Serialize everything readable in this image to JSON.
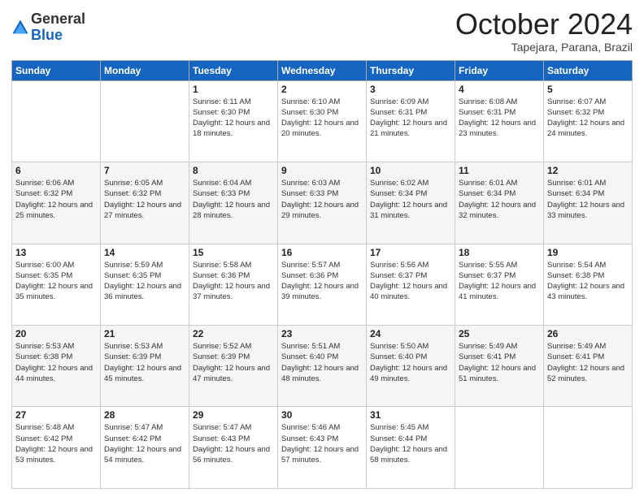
{
  "header": {
    "logo": {
      "line1": "General",
      "line2": "Blue"
    },
    "title": "October 2024",
    "subtitle": "Tapejara, Parana, Brazil"
  },
  "days_of_week": [
    "Sunday",
    "Monday",
    "Tuesday",
    "Wednesday",
    "Thursday",
    "Friday",
    "Saturday"
  ],
  "weeks": [
    [
      {
        "day": "",
        "info": ""
      },
      {
        "day": "",
        "info": ""
      },
      {
        "day": "1",
        "info": "Sunrise: 6:11 AM\nSunset: 6:30 PM\nDaylight: 12 hours and 18 minutes."
      },
      {
        "day": "2",
        "info": "Sunrise: 6:10 AM\nSunset: 6:30 PM\nDaylight: 12 hours and 20 minutes."
      },
      {
        "day": "3",
        "info": "Sunrise: 6:09 AM\nSunset: 6:31 PM\nDaylight: 12 hours and 21 minutes."
      },
      {
        "day": "4",
        "info": "Sunrise: 6:08 AM\nSunset: 6:31 PM\nDaylight: 12 hours and 23 minutes."
      },
      {
        "day": "5",
        "info": "Sunrise: 6:07 AM\nSunset: 6:32 PM\nDaylight: 12 hours and 24 minutes."
      }
    ],
    [
      {
        "day": "6",
        "info": "Sunrise: 6:06 AM\nSunset: 6:32 PM\nDaylight: 12 hours and 25 minutes."
      },
      {
        "day": "7",
        "info": "Sunrise: 6:05 AM\nSunset: 6:32 PM\nDaylight: 12 hours and 27 minutes."
      },
      {
        "day": "8",
        "info": "Sunrise: 6:04 AM\nSunset: 6:33 PM\nDaylight: 12 hours and 28 minutes."
      },
      {
        "day": "9",
        "info": "Sunrise: 6:03 AM\nSunset: 6:33 PM\nDaylight: 12 hours and 29 minutes."
      },
      {
        "day": "10",
        "info": "Sunrise: 6:02 AM\nSunset: 6:34 PM\nDaylight: 12 hours and 31 minutes."
      },
      {
        "day": "11",
        "info": "Sunrise: 6:01 AM\nSunset: 6:34 PM\nDaylight: 12 hours and 32 minutes."
      },
      {
        "day": "12",
        "info": "Sunrise: 6:01 AM\nSunset: 6:34 PM\nDaylight: 12 hours and 33 minutes."
      }
    ],
    [
      {
        "day": "13",
        "info": "Sunrise: 6:00 AM\nSunset: 6:35 PM\nDaylight: 12 hours and 35 minutes."
      },
      {
        "day": "14",
        "info": "Sunrise: 5:59 AM\nSunset: 6:35 PM\nDaylight: 12 hours and 36 minutes."
      },
      {
        "day": "15",
        "info": "Sunrise: 5:58 AM\nSunset: 6:36 PM\nDaylight: 12 hours and 37 minutes."
      },
      {
        "day": "16",
        "info": "Sunrise: 5:57 AM\nSunset: 6:36 PM\nDaylight: 12 hours and 39 minutes."
      },
      {
        "day": "17",
        "info": "Sunrise: 5:56 AM\nSunset: 6:37 PM\nDaylight: 12 hours and 40 minutes."
      },
      {
        "day": "18",
        "info": "Sunrise: 5:55 AM\nSunset: 6:37 PM\nDaylight: 12 hours and 41 minutes."
      },
      {
        "day": "19",
        "info": "Sunrise: 5:54 AM\nSunset: 6:38 PM\nDaylight: 12 hours and 43 minutes."
      }
    ],
    [
      {
        "day": "20",
        "info": "Sunrise: 5:53 AM\nSunset: 6:38 PM\nDaylight: 12 hours and 44 minutes."
      },
      {
        "day": "21",
        "info": "Sunrise: 5:53 AM\nSunset: 6:39 PM\nDaylight: 12 hours and 45 minutes."
      },
      {
        "day": "22",
        "info": "Sunrise: 5:52 AM\nSunset: 6:39 PM\nDaylight: 12 hours and 47 minutes."
      },
      {
        "day": "23",
        "info": "Sunrise: 5:51 AM\nSunset: 6:40 PM\nDaylight: 12 hours and 48 minutes."
      },
      {
        "day": "24",
        "info": "Sunrise: 5:50 AM\nSunset: 6:40 PM\nDaylight: 12 hours and 49 minutes."
      },
      {
        "day": "25",
        "info": "Sunrise: 5:49 AM\nSunset: 6:41 PM\nDaylight: 12 hours and 51 minutes."
      },
      {
        "day": "26",
        "info": "Sunrise: 5:49 AM\nSunset: 6:41 PM\nDaylight: 12 hours and 52 minutes."
      }
    ],
    [
      {
        "day": "27",
        "info": "Sunrise: 5:48 AM\nSunset: 6:42 PM\nDaylight: 12 hours and 53 minutes."
      },
      {
        "day": "28",
        "info": "Sunrise: 5:47 AM\nSunset: 6:42 PM\nDaylight: 12 hours and 54 minutes."
      },
      {
        "day": "29",
        "info": "Sunrise: 5:47 AM\nSunset: 6:43 PM\nDaylight: 12 hours and 56 minutes."
      },
      {
        "day": "30",
        "info": "Sunrise: 5:46 AM\nSunset: 6:43 PM\nDaylight: 12 hours and 57 minutes."
      },
      {
        "day": "31",
        "info": "Sunrise: 5:45 AM\nSunset: 6:44 PM\nDaylight: 12 hours and 58 minutes."
      },
      {
        "day": "",
        "info": ""
      },
      {
        "day": "",
        "info": ""
      }
    ]
  ]
}
